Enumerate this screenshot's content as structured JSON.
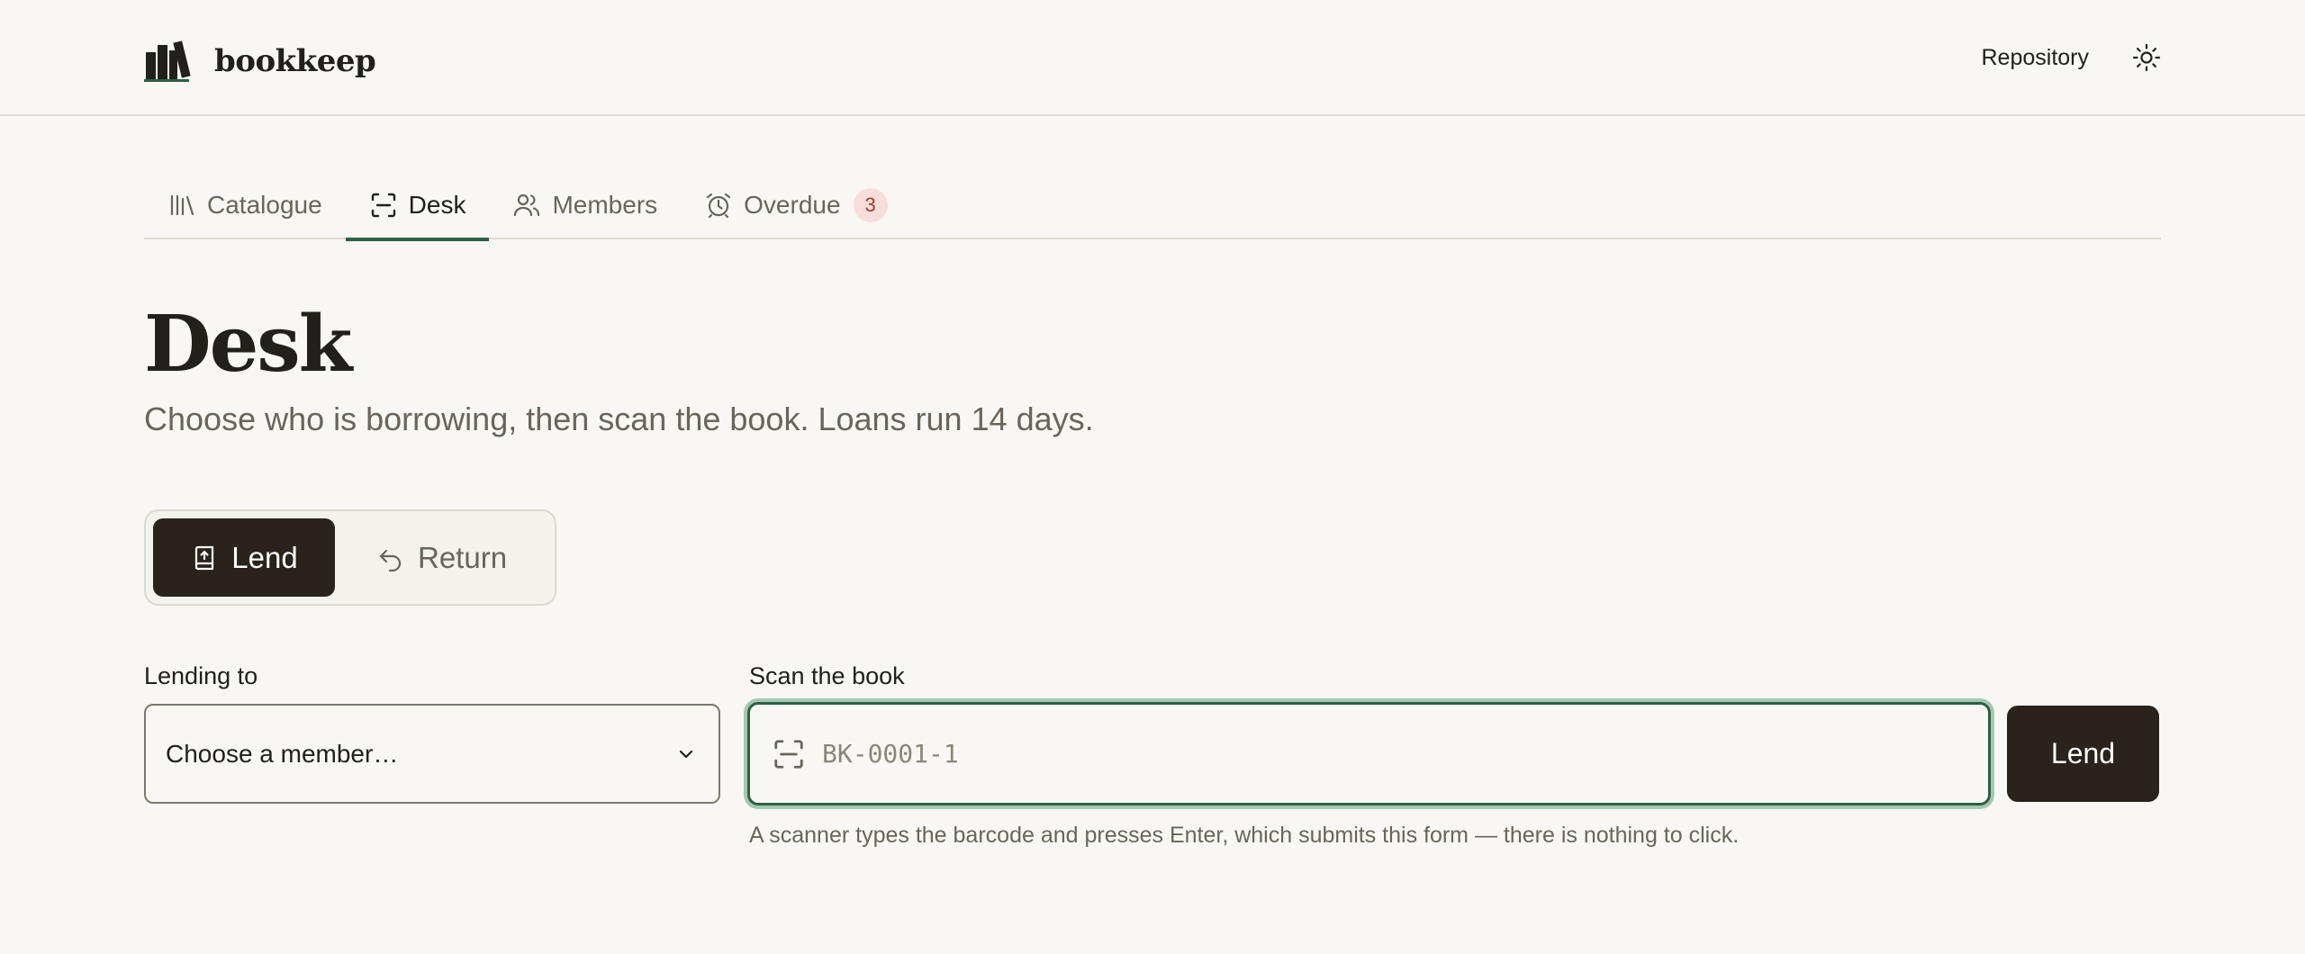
{
  "header": {
    "brand_name": "bookkeep",
    "repository_label": "Repository"
  },
  "tabs": [
    {
      "label": "Catalogue",
      "icon": "library-icon",
      "active": false
    },
    {
      "label": "Desk",
      "icon": "scan-icon",
      "active": true
    },
    {
      "label": "Members",
      "icon": "users-icon",
      "active": false
    },
    {
      "label": "Overdue",
      "icon": "alarm-clock-icon",
      "active": false,
      "badge": "3"
    }
  ],
  "page": {
    "title": "Desk",
    "subtitle": "Choose who is borrowing, then scan the book. Loans run 14 days."
  },
  "mode_toggle": {
    "lend_label": "Lend",
    "return_label": "Return",
    "selected": "Lend"
  },
  "form": {
    "member_label": "Lending to",
    "member_placeholder": "Choose a member…",
    "scan_label": "Scan the book",
    "scan_placeholder": "BK-0001-1",
    "scan_value": "",
    "submit_label": "Lend",
    "hint": "A scanner types the barcode and presses Enter, which submits this form — there is nothing to click."
  },
  "colors": {
    "background": "#f8f7f3",
    "ink": "#23201c",
    "accent_green": "#2f5f44",
    "dark_button": "#2a231c",
    "badge_bg": "#f7dedb",
    "badge_text": "#a13a30"
  }
}
